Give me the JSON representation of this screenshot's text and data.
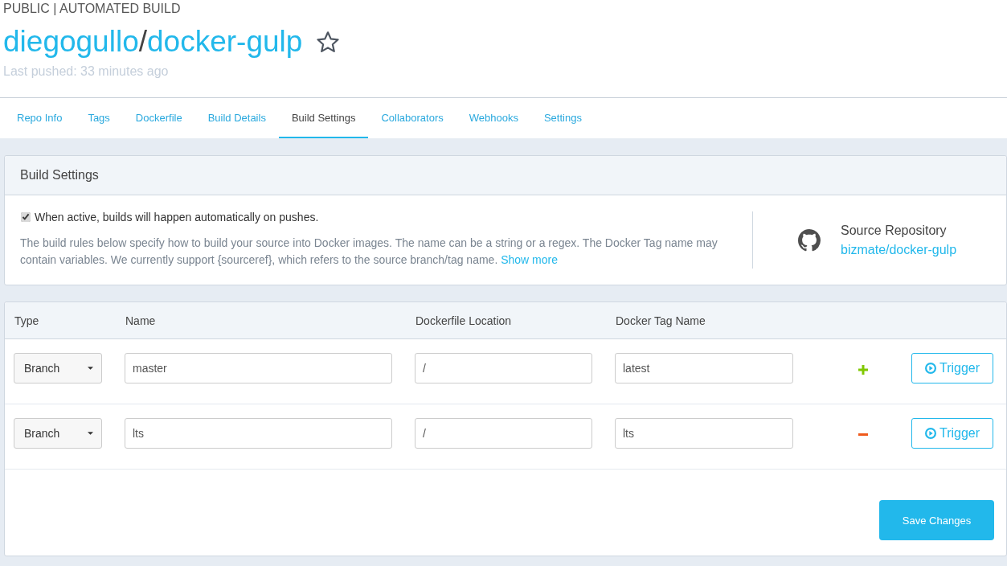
{
  "header": {
    "visibility": "PUBLIC | AUTOMATED BUILD",
    "owner": "diegogullo",
    "separator": "/",
    "repo": "docker-gulp",
    "starred": false,
    "last_pushed": "Last pushed: 33 minutes ago"
  },
  "tabs": [
    {
      "label": "Repo Info",
      "selected": false
    },
    {
      "label": "Tags",
      "selected": false
    },
    {
      "label": "Dockerfile",
      "selected": false
    },
    {
      "label": "Build Details",
      "selected": false
    },
    {
      "label": "Build Settings",
      "selected": true
    },
    {
      "label": "Collaborators",
      "selected": false
    },
    {
      "label": "Webhooks",
      "selected": false
    },
    {
      "label": "Settings",
      "selected": false
    }
  ],
  "build_settings": {
    "title": "Build Settings",
    "autobuild": {
      "label": "When active, builds will happen automatically on pushes.",
      "checked": true
    },
    "description": "The build rules below specify how to build your source into Docker images. The name can be a string or a regex. The Docker Tag name may contain variables. We currently support {sourceref}, which refers to the source branch/tag name.",
    "show_more": "Show more",
    "source": {
      "label": "Source Repository",
      "link": "bizmate/docker-gulp"
    }
  },
  "rules": {
    "columns": [
      "Type",
      "Name",
      "Dockerfile Location",
      "Docker Tag Name"
    ],
    "rows": [
      {
        "kind": "add",
        "type": "Branch",
        "name": "master",
        "location": "/",
        "tag": "latest",
        "trigger": "Trigger"
      },
      {
        "kind": "remove",
        "type": "Branch",
        "name": "lts",
        "location": "/",
        "tag": "lts",
        "trigger": "Trigger"
      }
    ],
    "save": "Save Changes"
  }
}
